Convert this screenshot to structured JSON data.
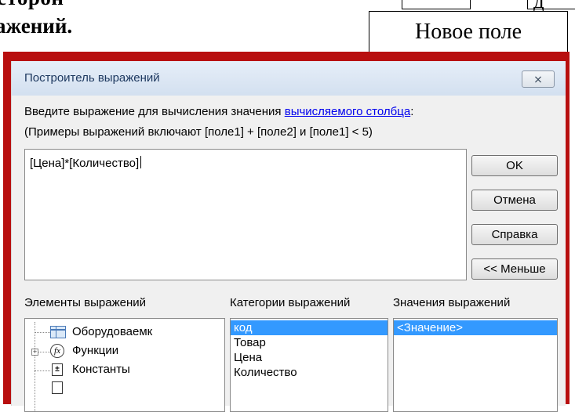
{
  "document": {
    "top_text_fragment": "сторон",
    "suffix_text": "ажений.",
    "box_b_text": "д",
    "callout_label": "Новое поле"
  },
  "dialog": {
    "title": "Построитель выражений",
    "close_label": "⨯",
    "prompt_text": "Введите выражение для вычисления значения ",
    "prompt_link": "вычисляемого столбца",
    "prompt_colon": ":",
    "examples_text": "(Примеры выражений включают [поле1] + [поле2] и [поле1] < 5)",
    "expression": "[Цена]*[Количество]",
    "buttons": {
      "ok": "OK",
      "cancel": "Отмена",
      "help": "Справка",
      "less": "<< Меньше"
    },
    "sections": {
      "elements": "Элементы выражений",
      "categories": "Категории выражений",
      "values": "Значения выражений"
    },
    "elements_tree": [
      {
        "label": "Оборудоваемк",
        "icon": "table-icon"
      },
      {
        "label": "Функции",
        "icon": "function-icon"
      },
      {
        "label": "Константы",
        "icon": "constants-icon"
      }
    ],
    "categories_list": [
      "код",
      "Товар",
      "Цена",
      "Количество"
    ],
    "selected_category": "код",
    "values_list": [
      "<Значение>"
    ],
    "selected_value": "<Значение>"
  },
  "colors": {
    "frame_red": "#b80f0f",
    "selection_blue": "#3399ff",
    "link_blue": "#0000ee"
  }
}
